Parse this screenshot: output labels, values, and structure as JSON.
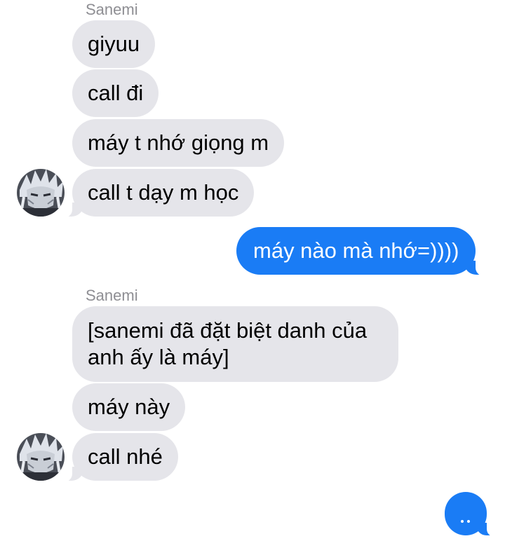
{
  "colors": {
    "incoming_bubble": "#e5e5ea",
    "outgoing_bubble": "#1a7cf5",
    "sender_name": "#8e8e93"
  },
  "conversation": {
    "group1": {
      "sender": "Sanemi",
      "messages": [
        "giyuu",
        "call đi",
        "máy t nhớ giọng m",
        "call t dạy m học"
      ]
    },
    "outgoing": {
      "messages": [
        "máy nào mà nhớ=))))"
      ]
    },
    "group2": {
      "sender": "Sanemi",
      "messages": [
        "[sanemi đã đặt biệt danh của anh ấy là máy]",
        "máy này",
        "call nhé"
      ]
    },
    "typing_indicator": {
      "icon": "typing-dots-icon"
    }
  }
}
